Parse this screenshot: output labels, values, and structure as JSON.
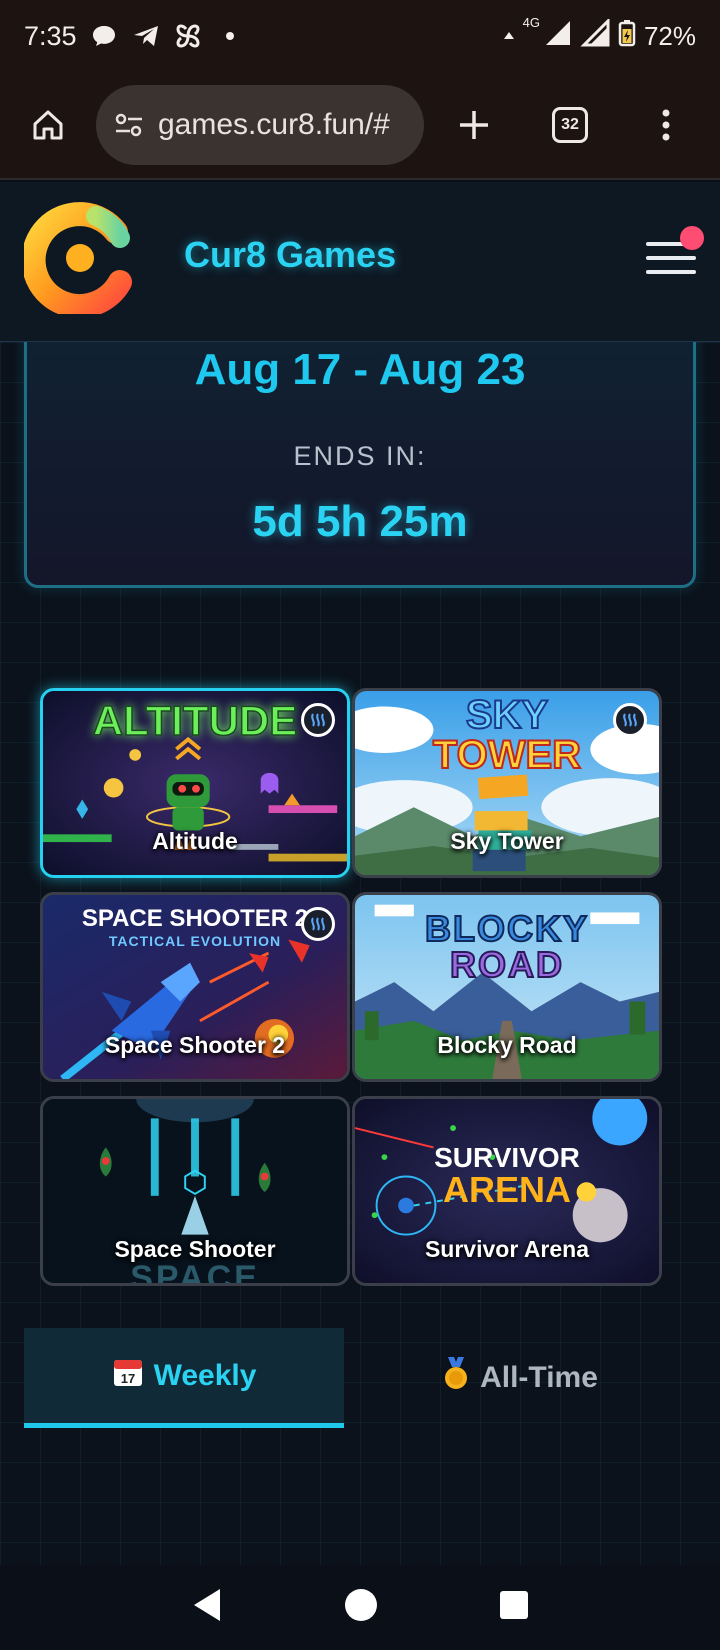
{
  "status_bar": {
    "time": "7:35",
    "network": "4G",
    "battery": "72%"
  },
  "browser": {
    "url": "games.cur8.fun/#",
    "tab_count": "32"
  },
  "site": {
    "title": "Cur8 Games"
  },
  "week_card": {
    "range": "Aug 17 - Aug 23",
    "ends_label": "ENDS IN:",
    "countdown": "5d 5h 25m"
  },
  "games": [
    {
      "name": "Altitude",
      "art_title": "ALTITUDE",
      "badge": true,
      "selected": true
    },
    {
      "name": "Sky Tower",
      "art_title": "SKY TOWER",
      "badge": true,
      "selected": false
    },
    {
      "name": "Space Shooter 2",
      "art_title": "SPACE SHOOTER 2",
      "art_subtitle": "TACTICAL EVOLUTION",
      "badge": true,
      "selected": false
    },
    {
      "name": "Blocky Road",
      "art_title": "BLOCKY ROAD",
      "badge": false,
      "selected": false
    },
    {
      "name": "Space Shooter",
      "art_title": "SPACE",
      "badge": false,
      "selected": false
    },
    {
      "name": "Survivor Arena",
      "art_title": "SURVIVOR",
      "art_title2": "ARENA",
      "badge": false,
      "selected": false
    }
  ],
  "tabs": {
    "weekly": {
      "label": "Weekly",
      "icon": "calendar-icon",
      "icon_text": "July 17"
    },
    "alltime": {
      "label": "All-Time",
      "icon": "medal-icon"
    }
  },
  "colors": {
    "accent": "#2bd3f3",
    "background": "#0b121b",
    "notification": "#ff4c73"
  }
}
